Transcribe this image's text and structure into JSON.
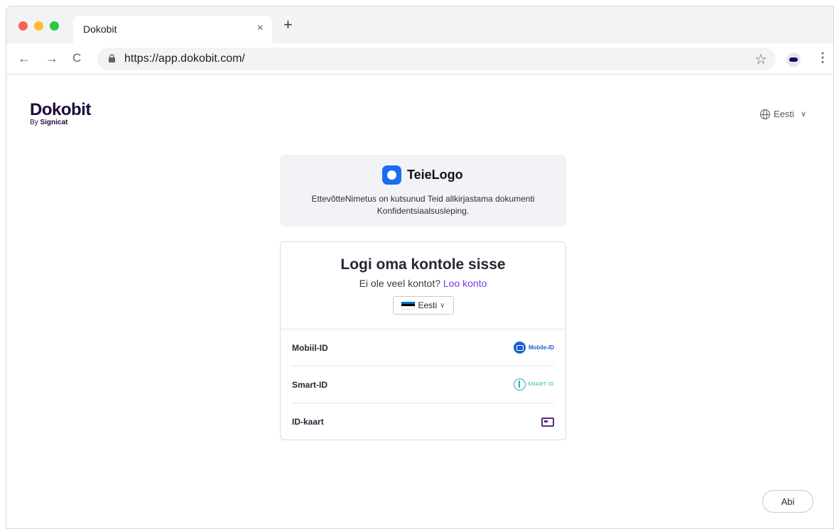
{
  "browser": {
    "tab_title": "Dokobit",
    "close_icon": "×",
    "new_tab_icon": "+",
    "url": "https://app.dokobit.com/",
    "back_icon": "←",
    "forward_icon": "→",
    "reload_icon": "C",
    "star_icon": "☆",
    "menu_icon": "⋮"
  },
  "header": {
    "brand_name": "Dokobit",
    "brand_sub_prefix": "By",
    "brand_sub_name": "Signicat",
    "language": "Eesti",
    "chevron": "∨"
  },
  "invite": {
    "logo_text": "TeieLogo",
    "message": "EttevõtteNimetus on kutsunud Teid allkirjastama dokumenti Konfidentsiaalsusleping."
  },
  "login": {
    "title": "Logi oma kontole sisse",
    "sub_text": "Ei ole veel kontot?",
    "sub_link": "Loo konto",
    "language_value": "Eesti",
    "language_chevron": "∨",
    "methods": [
      {
        "label": "Mobiil-ID",
        "logo_text": "Mobile-ID",
        "icon": "mobile-id-icon"
      },
      {
        "label": "Smart-ID",
        "logo_text": "SMART-ID",
        "icon": "smart-id-icon"
      },
      {
        "label": "ID-kaart",
        "logo_text": "",
        "icon": "id-card-icon"
      }
    ]
  },
  "help": {
    "label": "Abi"
  },
  "colors": {
    "brand": "#1e0a3c",
    "link": "#7c3aed",
    "logo_blue": "#1a6cf0",
    "smart_id": "#1fb5a8",
    "flag_blue": "#0072ce",
    "flag_black": "#000000",
    "flag_white": "#ffffff"
  }
}
